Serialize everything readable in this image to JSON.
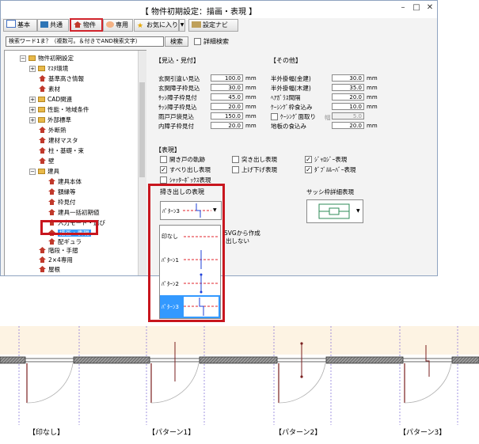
{
  "window": {
    "title": "【 物件初期設定：描画・表現 】",
    "controls": [
      "–",
      "□",
      "✕"
    ]
  },
  "toolbar": {
    "buttons": [
      {
        "label": "基本"
      },
      {
        "label": "共通"
      },
      {
        "label": "物件"
      },
      {
        "label": "専用"
      },
      {
        "label": "お気に入り"
      },
      {
        "label": "設定ナビ"
      }
    ],
    "dropdown_arrow": "▼"
  },
  "search": {
    "text": "検索ワード1ま？（複数可。＆付きでAND検索文字）",
    "button": "検索",
    "detail_label": "詳細検索"
  },
  "tree": {
    "items": [
      {
        "label": "物件初期設定",
        "exp": "□"
      },
      {
        "label": "ﾏｽﾀ環境",
        "exp": "+"
      },
      {
        "label": "基準高さ情報"
      },
      {
        "label": "素材"
      },
      {
        "label": "CAD関連",
        "exp": "+"
      },
      {
        "label": "性能・地域条件",
        "exp": "+"
      },
      {
        "label": "外部標準",
        "exp": "+"
      },
      {
        "label": "外断熱"
      },
      {
        "label": "建材マスタ"
      },
      {
        "label": "柱・基礎・束"
      },
      {
        "label": "壁"
      },
      {
        "label": "建具",
        "exp": "□"
      },
      {
        "label": "建具本体"
      },
      {
        "label": "額縁等"
      },
      {
        "label": "枠見付"
      },
      {
        "label": "建具一括初期値"
      },
      {
        "label": "入力モード・選び"
      },
      {
        "label": "描画・表現"
      },
      {
        "label": "配ギュラ"
      },
      {
        "label": "階段・手摺"
      },
      {
        "label": "2×4専用"
      },
      {
        "label": "屋根"
      }
    ]
  },
  "mitsuke": {
    "title": "【見込・見付】",
    "rows": [
      {
        "label": "玄関引違い見込",
        "value": "100.0",
        "unit": "mm"
      },
      {
        "label": "玄関障子枠見込",
        "value": "30.0",
        "unit": "mm"
      },
      {
        "label": "ｻｯｼ障子枠見付",
        "value": "45.0",
        "unit": "mm"
      },
      {
        "label": "ｻｯｼ障子枠見込",
        "value": "20.0",
        "unit": "mm"
      },
      {
        "label": "雨戸戸袋見込",
        "value": "150.0",
        "unit": "mm"
      },
      {
        "label": "内障子枠見付",
        "value": "20.0",
        "unit": "mm"
      }
    ]
  },
  "sonota": {
    "title": "【その他】",
    "rows": [
      {
        "label": "半外掛幅(金建)",
        "value": "30.0",
        "unit": "mm"
      },
      {
        "label": "半外掛幅(木建)",
        "value": "35.0",
        "unit": "mm"
      },
      {
        "label": "ﾍｱｶﾞﾗｽ間隔",
        "value": "20.0",
        "unit": "mm"
      },
      {
        "label": "ｹｰｼﾝｸﾞ枠食込み",
        "value": "10.0",
        "unit": "mm"
      },
      {
        "label": "ｹｰｼﾝｸﾞ面取り",
        "sub": "幅",
        "value": "5.0",
        "unit": "",
        "disabled": true
      },
      {
        "label": "地板の食込み",
        "value": "20.0",
        "unit": "mm"
      }
    ]
  },
  "hyogen": {
    "title": "【表現】",
    "checks": [
      {
        "label": "開き戸の軌跡",
        "checked": false
      },
      {
        "label": "突き出し表現",
        "checked": false
      },
      {
        "label": "ｼﾞｬﾛｼﾞｰ表現",
        "checked": true
      },
      {
        "label": "すべり出し表現",
        "checked": true
      },
      {
        "label": "上げ下げ表現",
        "checked": false
      },
      {
        "label": "ﾀﾞﾌﾞﾙﾙｰﾊﾞｰ表現",
        "checked": true
      },
      {
        "label": "ｼｬｯﾀｰﾎﾞｯｸｽ表現",
        "checked": false
      }
    ],
    "check_mark": "✓"
  },
  "hakidashi": {
    "title": "掃き出しの表現",
    "selected": "ﾊﾟﾀｰﾝ3",
    "options": [
      "印なし",
      "ﾊﾟﾀｰﾝ1",
      "ﾊﾟﾀｰﾝ2",
      "ﾊﾟﾀｰﾝ3"
    ]
  },
  "sash_detail": {
    "title": "サッシ枠詳細表現"
  },
  "behind_text": {
    "line1": "SVGから作成",
    "line2": "出しない"
  },
  "captions": [
    "【印なし】",
    "【パターン1】",
    "【パターン2】",
    "【パターン3】"
  ],
  "colors": {
    "highlight_red": "#c8161e",
    "selection_blue": "#3399ff",
    "pattern_line_red": "#e0232b",
    "pattern_line_blue": "#1d3fd9"
  }
}
